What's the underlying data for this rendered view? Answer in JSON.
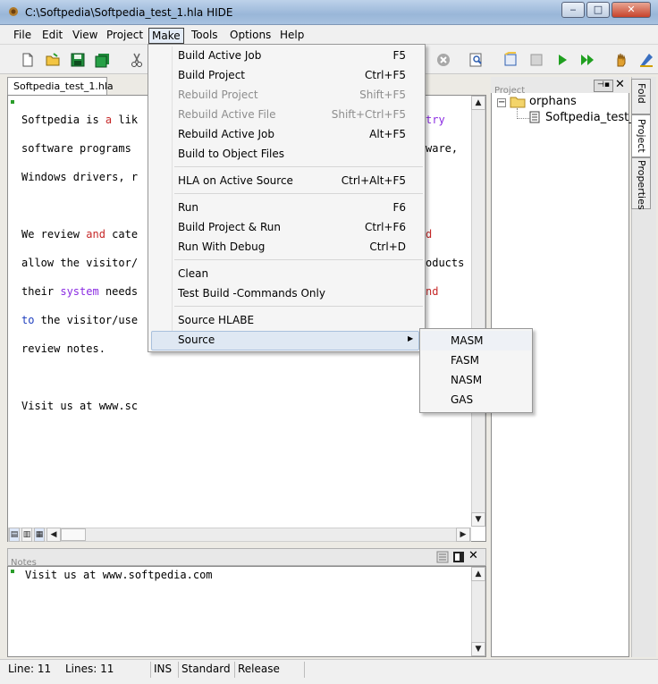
{
  "window": {
    "title": "C:\\Softpedia\\Softpedia_test_1.hla  HIDE",
    "controls": {
      "minimize": "‒",
      "maximize": "□",
      "close": "✕"
    }
  },
  "menubar": {
    "items": [
      "File",
      "Edit",
      "View",
      "Project",
      "Make",
      "Tools",
      "Options",
      "Help"
    ],
    "active": "Make"
  },
  "document_tab": {
    "label": "Softpedia_test_1.hla"
  },
  "editor": {
    "line1": [
      "Softpedia is ",
      "a",
      " lik"
    ],
    "line1_tail": "try",
    "line2": "software programs ",
    "line2_tail": "ware,",
    "line3": "Windows drivers, r",
    "line5": [
      "We review ",
      "and",
      " cate"
    ],
    "line6": "allow the visitor/",
    "line6_tail": "d",
    "line7": [
      "their ",
      "system",
      " needs"
    ],
    "line7_tail": "oducts",
    "line8": [
      "to",
      " the visitor/use"
    ],
    "line8_tail": "nd",
    "line9": "review notes.",
    "line11": "Visit us at www.sc"
  },
  "notes": {
    "title": "Notes",
    "text": "Visit us at www.softpedia.com"
  },
  "project_panel": {
    "title": "Project",
    "tree": [
      {
        "label": "orphans",
        "children": [
          "Softpedia_test_"
        ]
      }
    ]
  },
  "side_tabs": [
    "Fold",
    "Project",
    "Properties"
  ],
  "make_menu": {
    "items": [
      {
        "label": "Build Active Job",
        "shortcut": "F5",
        "enabled": true
      },
      {
        "label": "Build Project",
        "shortcut": "Ctrl+F5",
        "enabled": true
      },
      {
        "label": "Rebuild Project",
        "shortcut": "Shift+F5",
        "enabled": false
      },
      {
        "label": "Rebuild Active File",
        "shortcut": "Shift+Ctrl+F5",
        "enabled": false
      },
      {
        "label": "Rebuild Active Job",
        "shortcut": "Alt+F5",
        "enabled": true
      },
      {
        "label": "Build to Object Files",
        "shortcut": "",
        "enabled": true
      },
      {
        "label": "HLA on Active Source",
        "shortcut": "Ctrl+Alt+F5",
        "enabled": true
      },
      {
        "label": "Run",
        "shortcut": "F6",
        "enabled": true
      },
      {
        "label": "Build Project & Run",
        "shortcut": "Ctrl+F6",
        "enabled": true
      },
      {
        "label": "Run With Debug",
        "shortcut": "Ctrl+D",
        "enabled": true
      },
      {
        "label": "Clean",
        "shortcut": "",
        "enabled": true
      },
      {
        "label": "Test Build -Commands Only",
        "shortcut": "",
        "enabled": true
      },
      {
        "label": "Source HLABE",
        "shortcut": "",
        "enabled": true
      },
      {
        "label": "Source",
        "shortcut": "",
        "enabled": true,
        "submenu": true
      }
    ]
  },
  "source_submenu": {
    "items": [
      "MASM",
      "FASM",
      "NASM",
      "GAS"
    ]
  },
  "statusbar": {
    "line": "Line: 11",
    "lines": "Lines: 11",
    "mode": "INS",
    "build": "Standard",
    "config": "Release"
  },
  "colors": {
    "accent_red": "#c62828",
    "accent_purple": "#8a2be2",
    "keyword_blue": "#1f3fbf",
    "menu_highlight": "#dfe8f3"
  }
}
